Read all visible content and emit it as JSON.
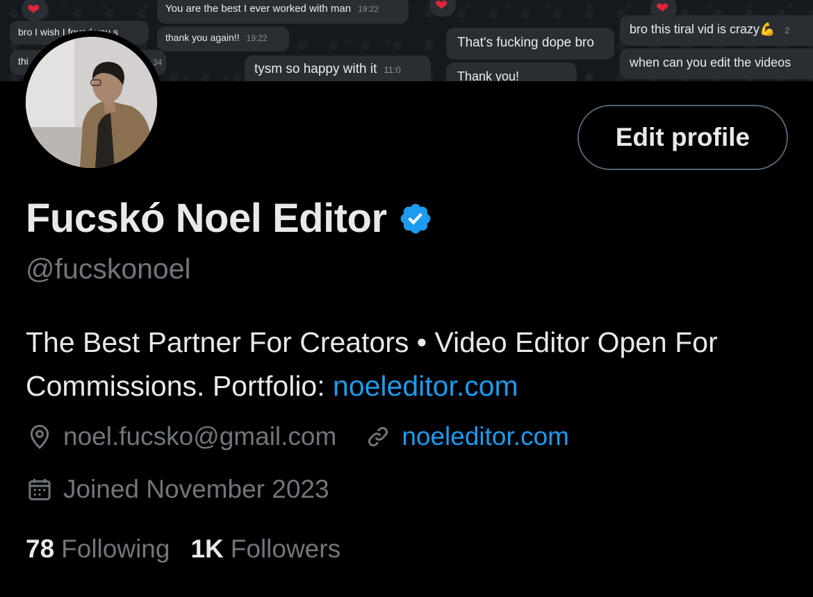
{
  "banner": {
    "chat_messages": [
      {
        "text": "You are the best I ever worked with man",
        "time": "19:22"
      },
      {
        "text": "bro I wish I found you s",
        "time": ""
      },
      {
        "text": "thank you again!!",
        "time": "19:22"
      },
      {
        "text": "thi",
        "time": ""
      },
      {
        "text": "34",
        "time": ""
      },
      {
        "text": "tysm so happy with it",
        "time": "11:0"
      },
      {
        "text": "That's fucking dope bro",
        "time": ""
      },
      {
        "text": "Thank you!",
        "time": ""
      },
      {
        "text": "bro this tiral vid is crazy💪",
        "time": "2"
      },
      {
        "text": "when can you edit the videos",
        "time": ""
      }
    ],
    "reaction": "❤"
  },
  "profile": {
    "display_name": "Fucskó Noel Editor",
    "handle": "@fucskonoel",
    "verified_icon": "verified-badge-icon",
    "edit_button_label": "Edit profile",
    "bio_text": "The Best Partner For Creators • Video Editor Open For Commissions. Portfolio: ",
    "bio_link": "noeleditor.com",
    "location": "noel.fucsko@gmail.com",
    "location_icon": "location-pin-icon",
    "website": "noeleditor.com",
    "website_icon": "link-icon",
    "joined": "Joined November 2023",
    "joined_icon": "calendar-icon",
    "following_count": "78",
    "following_label": "Following",
    "followers_count": "1K",
    "followers_label": "Followers"
  },
  "colors": {
    "background": "#000000",
    "primary_text": "#e7e9ea",
    "secondary_text": "#71767b",
    "link": "#1d9bf0",
    "verified": "#1d9bf0",
    "button_border": "#536471"
  }
}
